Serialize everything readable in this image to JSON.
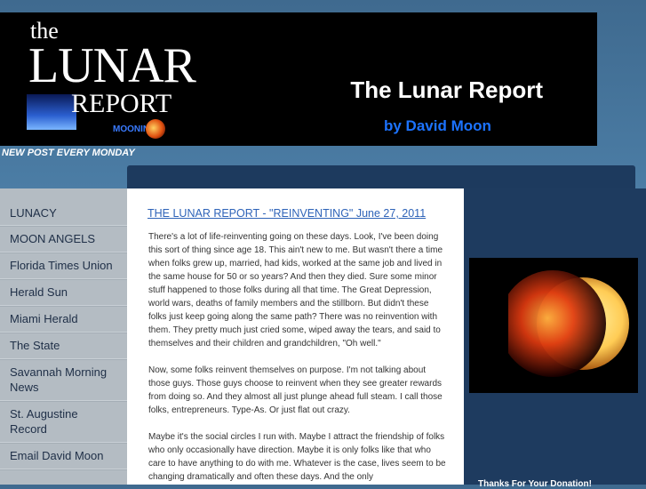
{
  "header": {
    "logo": {
      "the": "the",
      "lunar": "LUNAR",
      "report": "REPORT",
      "badge": "MOONING"
    },
    "title": "The Lunar Report",
    "subtitle": "by David Moon",
    "tagline": "NEW POST EVERY MONDAY"
  },
  "sidebar": {
    "items": [
      {
        "label": "LUNACY"
      },
      {
        "label": "MOON ANGELS"
      },
      {
        "label": "Florida Times Union"
      },
      {
        "label": "Herald Sun"
      },
      {
        "label": "Miami Herald"
      },
      {
        "label": "The State"
      },
      {
        "label": "Savannah Morning News"
      },
      {
        "label": "St. Augustine Record"
      },
      {
        "label": "Email David Moon"
      }
    ]
  },
  "post": {
    "title": "THE LUNAR REPORT - \"REINVENTING\" June 27, 2011",
    "paragraphs": [
      "There's a lot of life-reinventing going on these days.  Look, I've been doing this sort of thing since age 18.  This ain't new to me.  But wasn't there a time when folks grew up, married, had kids, worked at the same job and lived in the same house for 50 or so years?  And then they died.  Sure some minor stuff happened to those folks during all that time.  The Great Depression, world wars, deaths of family members and the stillborn.  But didn't these folks just keep going along the same path?  There was no reinvention with them.  They pretty much just cried some, wiped away the tears, and said to themselves and their children and grandchildren, \"Oh well.\"",
      "Now, some folks reinvent themselves on purpose.  I'm not talking about those guys.  Those guys choose to reinvent when they see greater rewards from doing so.  And they almost all just plunge ahead full steam.  I call those folks, entrepreneurs.  Type-As.  Or just flat out crazy.",
      "Maybe it's the social circles I run with.  Maybe I attract the friendship of folks who only occasionally have direction.  Maybe it is only folks like that who care to have anything to do with me.  Whatever is the case, lives seem to be changing dramatically and often these days.  And the only"
    ]
  },
  "right": {
    "thanks": "Thanks For Your Donation!"
  },
  "colors": {
    "header_bg": "#000000",
    "title_text": "#ffffff",
    "subtitle_text": "#1c73ff",
    "link": "#2e63b8",
    "sidebar_bg": "#b4bcc3",
    "right_bg": "#1e3b5f"
  }
}
